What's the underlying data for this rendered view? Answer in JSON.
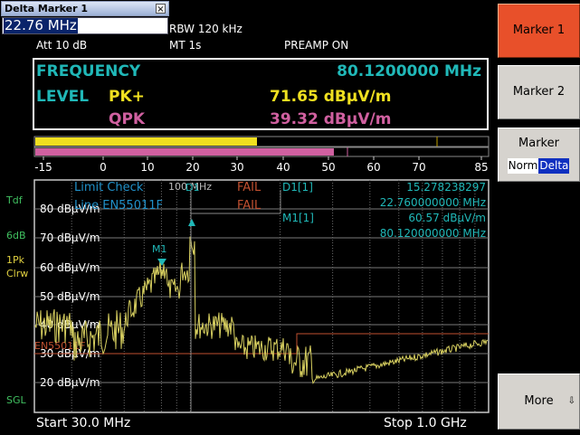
{
  "popup": {
    "title": "Delta Marker 1",
    "close": "×",
    "value": "22.76 MHz"
  },
  "header": {
    "rbw": "RBW 120 kHz",
    "att": "Att  10 dB",
    "mt": "MT   1s",
    "preamp": "PREAMP ON"
  },
  "result": {
    "frequency_label": "FREQUENCY",
    "frequency_value": "80.1200000 MHz",
    "level_label": "LEVEL",
    "pk_label": "PK+",
    "pk_value": "71.65 dBµV/m",
    "qpk_label": "QPK",
    "qpk_value": "39.32 dBµV/m"
  },
  "bargraph": {
    "pk_fraction": 0.49,
    "qpk_fraction": 0.66,
    "scale": [
      "-15",
      "0",
      "10",
      "20",
      "30",
      "40",
      "50",
      "60",
      "70",
      "85"
    ]
  },
  "side_labels": {
    "tdf": "Tdf",
    "db": "6dB",
    "detector": "1Pk",
    "clrw": "Clrw",
    "sgl": "SGL"
  },
  "plot": {
    "limit_check": "Limit Check",
    "limit_fail": "FAIL",
    "line_name": "Line EN55011F",
    "line_fail": "FAIL",
    "limit_line_label": "EN55011F",
    "marker_mhz_label": "100 MHz",
    "d1_label": "D1[1]",
    "d1_level": "15.278238297",
    "d1_freq": "22.760000000 MHz",
    "m1_label": "M1[1]",
    "m1_level": "60.57 dBµV/m",
    "m1_freq": "80.120000000 MHz",
    "m1_tag": "M1",
    "d1_tag": "D1",
    "y_ticks": [
      "80 dBµV/m",
      "70 dBµV/m",
      "60 dBµV/m",
      "50 dBµV/m",
      "40 dBµV/m",
      "30 dBµV/m",
      "20 dBµV/m"
    ]
  },
  "footer": {
    "start": "Start 30.0 MHz",
    "stop": "Stop 1.0 GHz"
  },
  "softkeys": {
    "marker1": "Marker 1",
    "marker2": "Marker 2",
    "marker": "Marker",
    "norm": "Norm",
    "delta": "Delta",
    "more": "More",
    "more_arrow": "⇩"
  },
  "colors": {
    "trace": "#d8d060",
    "limit": "#c05030",
    "active_softkey": "#e8502a"
  }
}
